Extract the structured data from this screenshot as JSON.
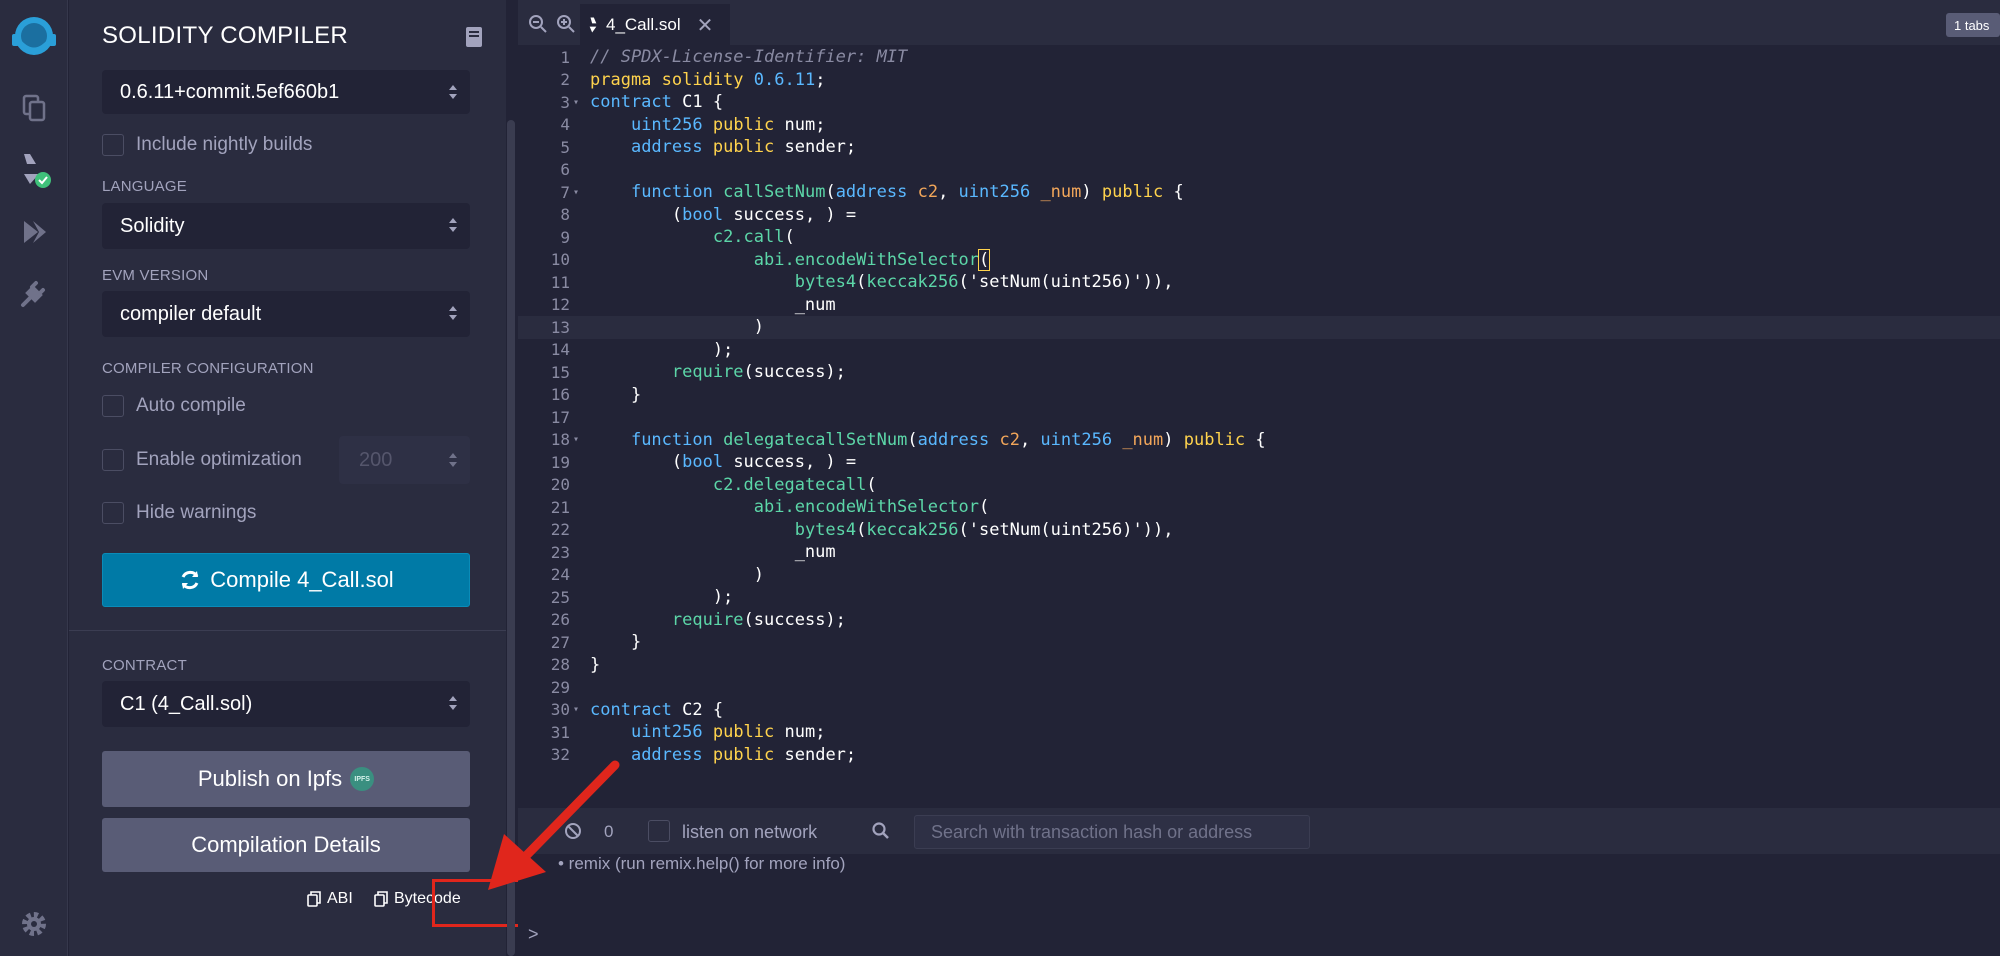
{
  "panel": {
    "title": "SOLIDITY COMPILER",
    "compiler_version": "0.6.11+commit.5ef660b1",
    "include_nightly": "Include nightly builds",
    "language_label": "LANGUAGE",
    "language": "Solidity",
    "evm_label": "EVM VERSION",
    "evm_version": "compiler default",
    "config_label": "COMPILER CONFIGURATION",
    "auto_compile": "Auto compile",
    "enable_optimization": "Enable optimization",
    "optimization_runs": "200",
    "hide_warnings": "Hide warnings",
    "compile_button": "Compile 4_Call.sol",
    "contract_label": "CONTRACT",
    "contract": "C1 (4_Call.sol)",
    "publish_button": "Publish on Ipfs",
    "ipfs_badge": "IPFS",
    "details_button": "Compilation Details",
    "abi_link": "ABI",
    "bytecode_link": "Bytecode"
  },
  "editor": {
    "tab_name": "4_Call.sol",
    "close_glyph": "✕",
    "tabs_count": "1 tabs",
    "active_line": 13
  },
  "terminal": {
    "tx_count": "0",
    "listen_label": "listen on network",
    "search_placeholder": "Search with transaction hash or address",
    "message": "•  remix (run remix.help() for more info)",
    "prompt": ">"
  },
  "colors": {
    "accent_blue": "#007aa6",
    "highlight_red": "#e0261c",
    "remix_logo": "#2a9fd8",
    "compile_check": "#3fc17a"
  },
  "icons": [
    "remix-logo-icon",
    "file-explorer-icon",
    "solidity-compiler-icon",
    "deploy-run-icon",
    "plugin-manager-icon",
    "settings-icon",
    "documentation-icon",
    "zoom-out-icon",
    "zoom-in-icon",
    "copy-icon",
    "refresh-icon",
    "clear-console-icon",
    "search-icon",
    "arrow-annotation-icon"
  ]
}
